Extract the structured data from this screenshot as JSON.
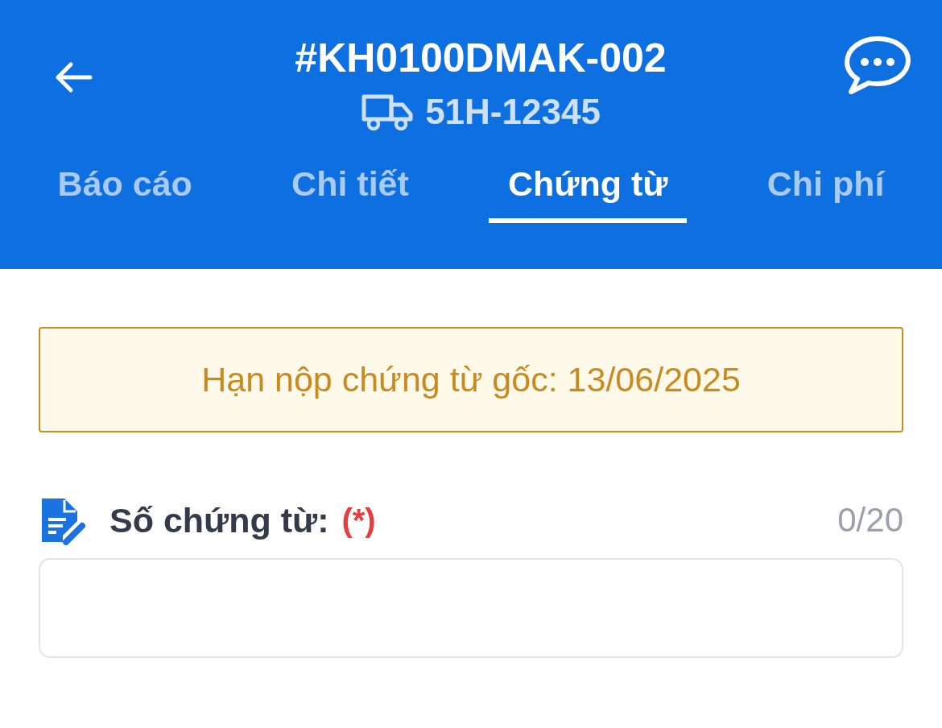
{
  "header": {
    "title": "#KH0100DMAK-002",
    "vehicle_plate": "51H-12345"
  },
  "tabs": [
    {
      "label": "Báo cáo",
      "selected": false
    },
    {
      "label": "Chi tiết",
      "selected": false
    },
    {
      "label": "Chứng từ",
      "selected": true
    },
    {
      "label": "Chi phí",
      "selected": false
    }
  ],
  "notice": "Hạn nộp chứng từ gốc: 13/06/2025",
  "field": {
    "label": "Số chứng từ:",
    "required_mark": "(*)",
    "counter": "0/20"
  }
}
